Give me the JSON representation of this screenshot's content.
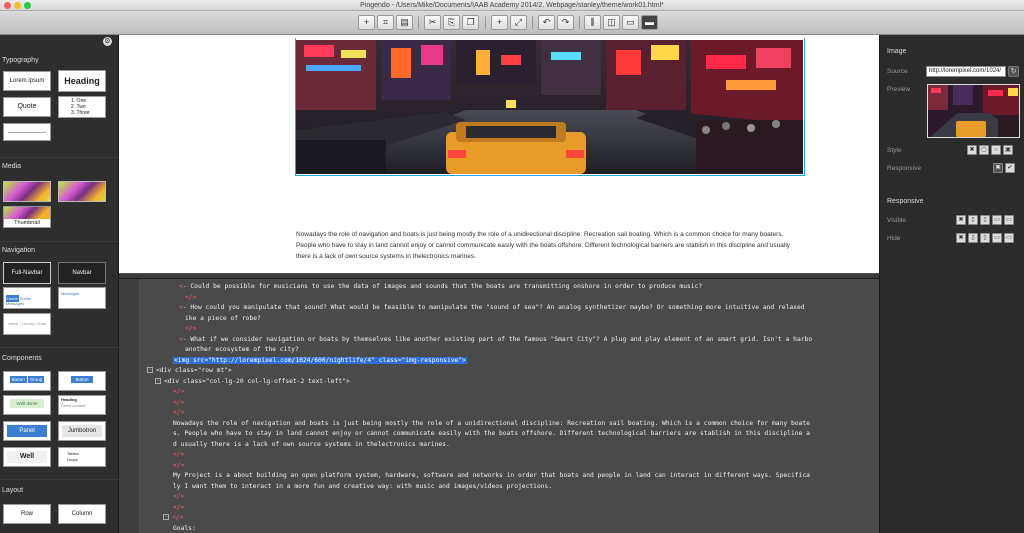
{
  "window": {
    "title": "Pingendo - /Users/Mike/Documents/IAAB Academy 2014/2. Webpage/stanley/theme/work01.html*"
  },
  "toolbar": {
    "buttons": [
      "plus-icon",
      "crop-icon",
      "save-icon",
      "scissors-icon",
      "paste-icon",
      "duplicate-icon",
      "add-icon",
      "resize-icon",
      "undo-icon",
      "redo-icon",
      "column-icon",
      "split-icon",
      "edit-icon",
      "layout-icon"
    ],
    "glyphs": [
      "+",
      "✂",
      "⬛",
      "✂",
      "⬚",
      "⬚",
      "+",
      "⤢",
      "↶",
      "↷",
      "⫿",
      "⫿",
      "⬚",
      "▭"
    ]
  },
  "sidebar": {
    "typography": {
      "title": "Typography",
      "lorem": "Lorem ipsum",
      "heading": "Heading",
      "quote": "Quote",
      "list": [
        "1. One",
        "2. Two",
        "3. Three"
      ]
    },
    "media": {
      "title": "Media",
      "thumbnail": "Thumbnail"
    },
    "navigation": {
      "title": "Navigation",
      "full_navbar": "Full-Navbar",
      "navbar": "Navbar",
      "tabs": [
        "Home",
        "Profile",
        "Messages"
      ],
      "breadcrumb": "Home / Library / Data"
    },
    "components": {
      "title": "Components",
      "button_group": [
        "Button",
        "Group"
      ],
      "button": "Button",
      "alert": "Well done!",
      "panel_heading": "Heading",
      "panel_title": "Panel content",
      "panel": "Panel",
      "jumbotron": "Jumbotron",
      "well": "Well",
      "list_items": [
        "Tables",
        "Drops"
      ]
    },
    "layout": {
      "title": "Layout",
      "row": "Row",
      "column": "Column"
    }
  },
  "canvas": {
    "paragraph": "Nowadays the role of navigation and boats is just being mostly the role of a unidirectional discipline: Recreation sail boating. Which is a common choice for many boaters. People who have to stay in land cannot enjoy or cannot communicate easily with the boats offshore. Different technological barriers are stablish in this discipline and usually there is a lack of own source systems in thelectronics marines."
  },
  "code": {
    "lines": [
      {
        "indent": 60,
        "html": "<span class='red'>&lt;</span>- Could be possible for musicians to use the data of images and sounds that the boats are transmitting onshore in order to produce music?"
      },
      {
        "indent": 66,
        "html": "<span class='red'>&lt;/&gt;</span>"
      },
      {
        "indent": 60,
        "html": "<span class='red'>&lt;</span>- How could you manipulate that sound? What would be feasible to manipulate the \"sound of sea\"? An analog synthetizer maybe? Or something more intuitive and relaxed"
      },
      {
        "indent": 66,
        "html": "ike a piece of robe?"
      },
      {
        "indent": 66,
        "html": "<span class='red'>&lt;/&gt;</span>"
      },
      {
        "indent": 60,
        "html": "<span class='red'>&lt;</span>- What if we consider navigation or boats by themselves like another existing part of the famous \"Smart City\"? A plug and play element of an smart grid. Isn't a harbo"
      },
      {
        "indent": 66,
        "html": "another ecosystem of the city?"
      },
      {
        "indent": 54,
        "html": "<span class='hl'>&lt;img src=\"http://lorempixel.com/1024/600/nightlife/4\" class=\"img-responsive\"&gt;</span>"
      },
      {
        "indent": 28,
        "html": "<span class='exp'>-</span>&lt;div class=\"row mt\"&gt;"
      },
      {
        "indent": 36,
        "html": "<span class='exp'>-</span>&lt;div class=\"col-lg-20 col-lg-offset-2 text-left\"&gt;"
      },
      {
        "indent": 54,
        "html": "<span class='red'>&lt;/&gt;</span>"
      },
      {
        "indent": 54,
        "html": "<span class='red'>&lt;/&gt;</span>"
      },
      {
        "indent": 54,
        "html": "<span class='red'>&lt;/&gt;</span>"
      },
      {
        "indent": 54,
        "html": "Nowadays the role of navigation and boats is just being mostly the role of a unidirectional discipline: Recreation sail boating. Which is a common choice for many boate"
      },
      {
        "indent": 54,
        "html": "s. People who have to stay in land cannot enjoy or cannot communicate easily with the boats offshore. Different technological barriers are stablish in this discipline a"
      },
      {
        "indent": 54,
        "html": "d usually there is a lack of own source systems in thelectronics marines."
      },
      {
        "indent": 54,
        "html": "<span class='red'>&lt;/&gt;</span>"
      },
      {
        "indent": 54,
        "html": "<span class='red'>&lt;/&gt;</span>"
      },
      {
        "indent": 54,
        "html": "My Project is a about building an open platform system, hardware, software and networks in order that boats and people in land can interact in different ways. Specifica"
      },
      {
        "indent": 54,
        "html": "ly I want them to interact in a more fun and creative way: with music and images/videos projections."
      },
      {
        "indent": 54,
        "html": "<span class='red'>&lt;/&gt;</span>"
      },
      {
        "indent": 54,
        "html": "<span class='red'>&lt;/&gt;</span>"
      },
      {
        "indent": 44,
        "html": "<span class='exp'>-</span><span class='red'>&lt;/&gt;</span>"
      },
      {
        "indent": 54,
        "html": "Goals:"
      }
    ]
  },
  "rpanel": {
    "image_title": "Image",
    "source_label": "Source",
    "source_value": "http://lorempixel.com/1024/",
    "preview_label": "Preview",
    "style_label": "Style",
    "responsive_label": "Responsive",
    "responsive_title": "Responsive",
    "visible_label": "Visible",
    "hide_label": "Hide"
  },
  "colors": {
    "selection": "#1fa8e0",
    "code_bg": "#4a4a4a",
    "panel_bg": "#2b2b2b",
    "highlight": "#2f6fd6"
  }
}
